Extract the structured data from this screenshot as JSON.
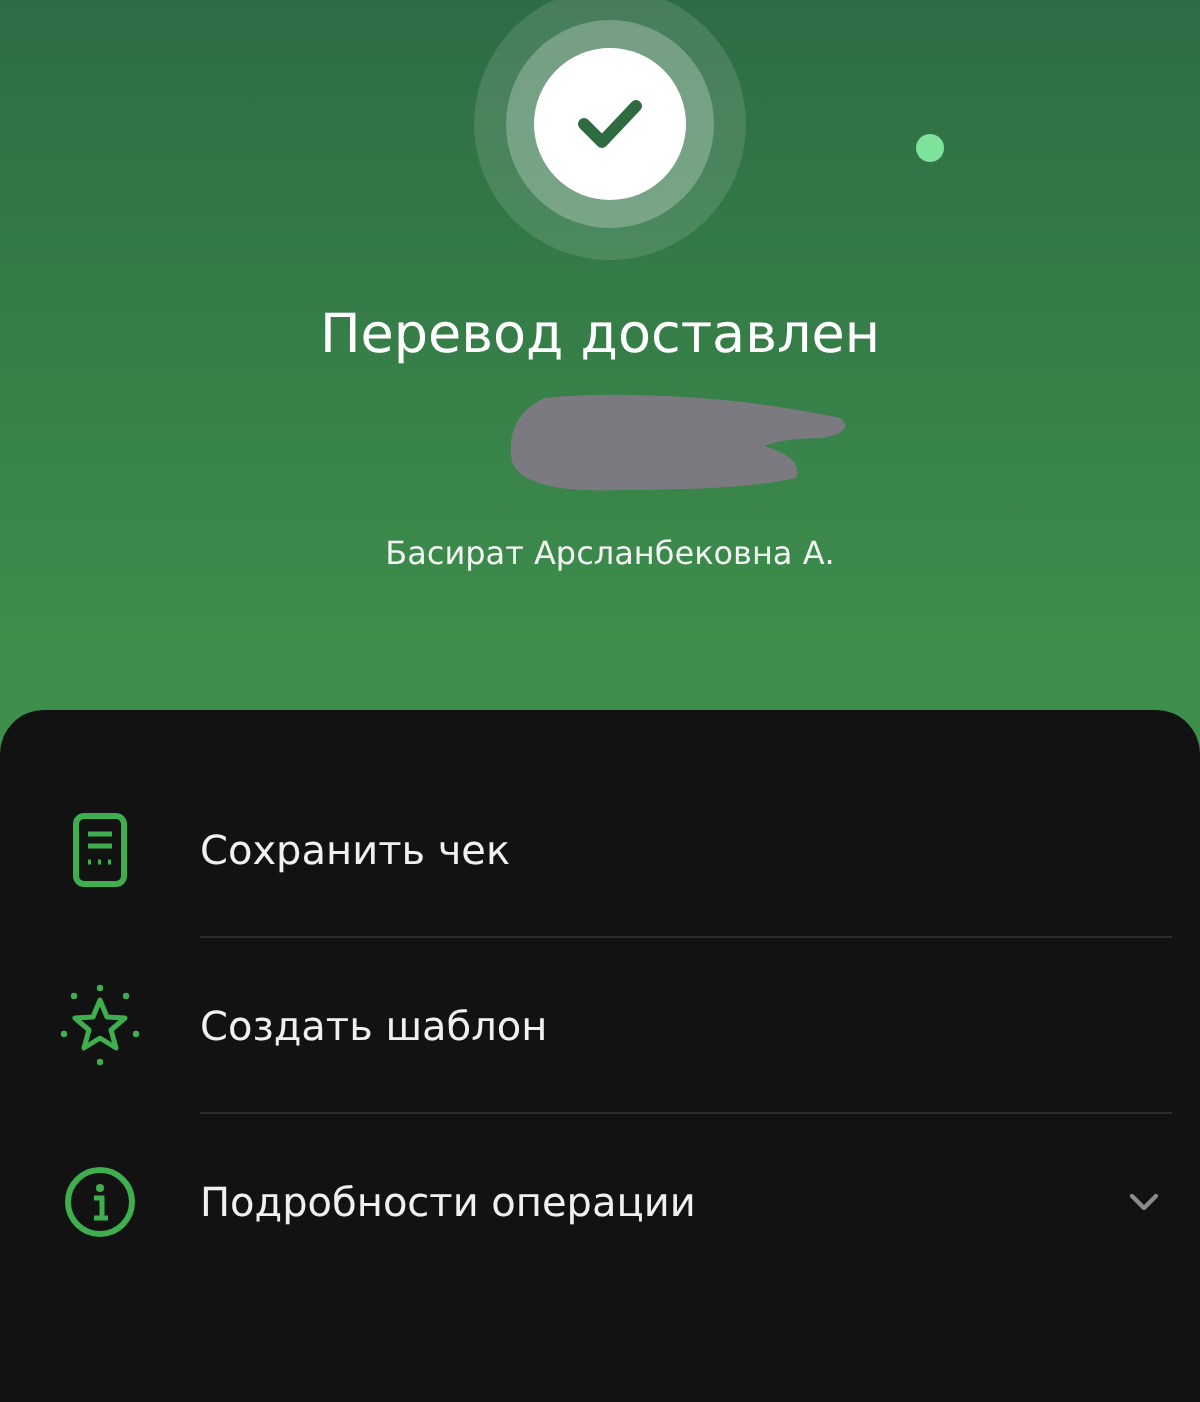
{
  "header": {
    "title": "Перевод доставлен",
    "recipient": "Басират Арсланбековна А."
  },
  "actions": [
    {
      "kind": "receipt",
      "label": "Сохранить чек"
    },
    {
      "kind": "star",
      "label": "Создать шаблон"
    },
    {
      "kind": "info",
      "label": "Подробности операции",
      "expanded": false
    }
  ]
}
